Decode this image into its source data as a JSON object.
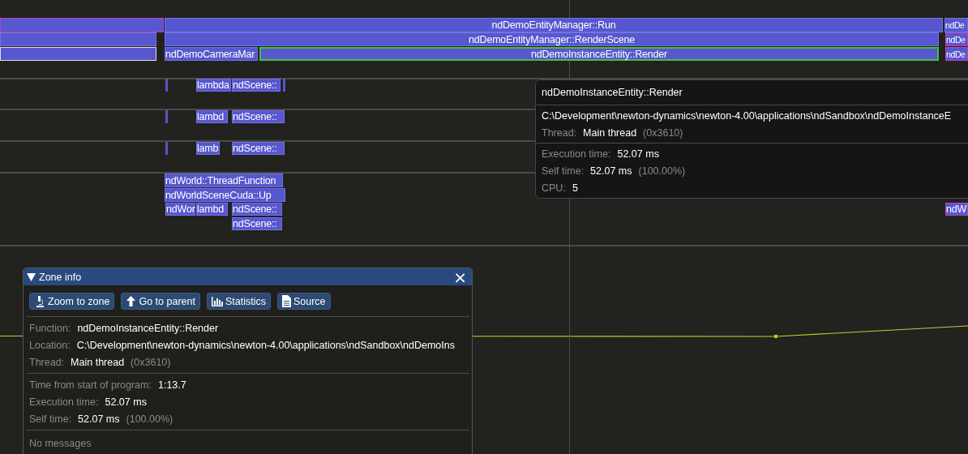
{
  "timeline": {
    "zones": [
      {
        "kind": "zone",
        "color": "#c040c0"
      },
      {
        "label": "ndDemoEntityManager::Run"
      },
      {
        "label": "ndDe"
      },
      {
        "kind": "zone"
      },
      {
        "label": "ndDemoEntityManager::RenderScene"
      },
      {
        "label": "ndDe",
        "color": "#c040c0"
      },
      {
        "kind": "zone",
        "color": "#e0e0e0"
      },
      {
        "label": "ndDemoCameraMar"
      },
      {
        "label": "ndDemoInstanceEntity::Render",
        "color": "#40c040"
      },
      {
        "label": "ndDe",
        "color": "#c040c0"
      },
      {
        "kind": "marker"
      },
      {
        "label": "lambda"
      },
      {
        "label": "ndScene::"
      },
      {
        "kind": "marker"
      },
      {
        "kind": "marker"
      },
      {
        "label": "lambd"
      },
      {
        "label": "ndScene::"
      },
      {
        "kind": "marker"
      },
      {
        "label": "lamb"
      },
      {
        "label": "ndScene::"
      },
      {
        "label": "ndWorld::ThreadFunction"
      },
      {
        "label": "ndWorldSceneCuda::Up"
      },
      {
        "label": "ndWor"
      },
      {
        "label": "lambd"
      },
      {
        "label": "ndScene::"
      },
      {
        "label": "ndScene::"
      },
      {
        "label": "ndW",
        "color": "#c040c0"
      }
    ]
  },
  "tooltip": {
    "title": "ndDemoInstanceEntity::Render",
    "location": "C:\\Development\\newton-dynamics\\newton-4.00\\applications\\ndSandbox\\ndDemoInstanceE",
    "sections": [
      [
        {
          "label": "Thread:",
          "value": "Main thread",
          "note": "(0x3610)"
        }
      ],
      [
        {
          "label": "Execution time:",
          "value": "52.07 ms"
        },
        {
          "label": "Self time:",
          "value": "52.07 ms",
          "note": "(100.00%)"
        },
        {
          "label": "CPU:",
          "value": "5"
        }
      ]
    ]
  },
  "zone_info": {
    "title": "Zone info",
    "close": "×",
    "buttons": [
      {
        "label": "Zoom to zone"
      },
      {
        "label": "Go to parent"
      },
      {
        "label": "Statistics"
      },
      {
        "label": "Source"
      }
    ],
    "sections": [
      [
        {
          "label": "Function:",
          "value": "ndDemoInstanceEntity::Render"
        },
        {
          "label": "Location:",
          "value": "C:\\Development\\newton-dynamics\\newton-4.00\\applications\\ndSandbox\\ndDemoIns"
        },
        {
          "label": "Thread:",
          "value": "Main thread",
          "note": "(0x3610)"
        }
      ],
      [
        {
          "label": "Time from start of program:",
          "value": "1:13.7"
        },
        {
          "label": "Execution time:",
          "value": "52.07 ms"
        },
        {
          "label": "Self time:",
          "value": "52.07 ms",
          "note": "(100.00%)"
        }
      ]
    ],
    "messages": "No messages"
  }
}
